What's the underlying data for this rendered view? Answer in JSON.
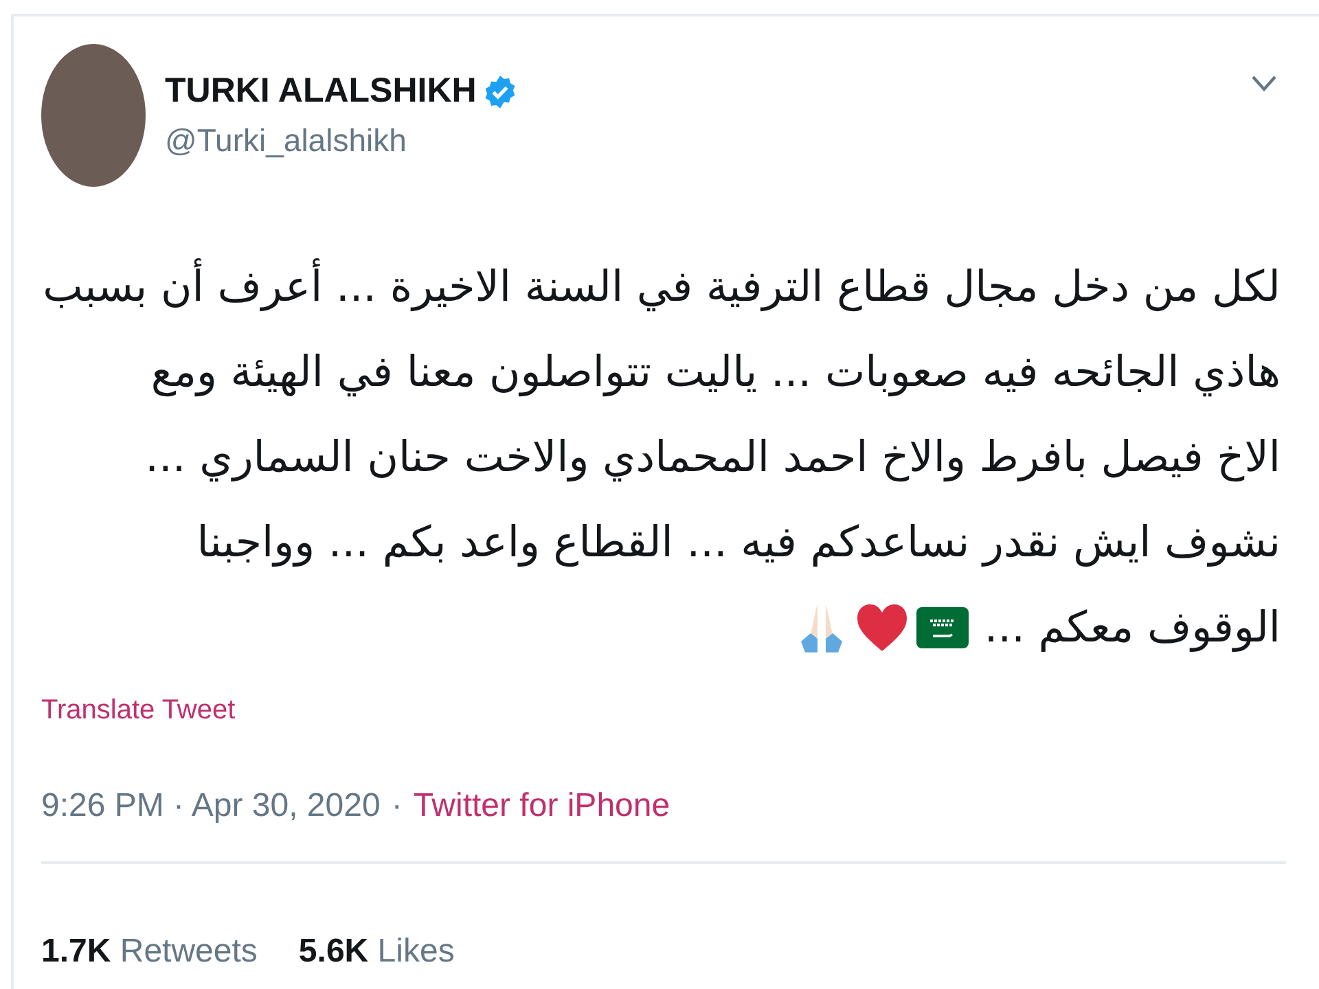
{
  "tweet": {
    "author": {
      "name": "TURKI ALALSHIKH",
      "verified": true,
      "handle": "@Turki_alalshikh"
    },
    "text_lines": [
      "لكل من دخل مجال قطاع الترفية في السنة الاخيرة ... أعرف أن بسبب",
      "هاذي الجائحه فيه صعوبات ... ياليت تتواصلون معنا في الهيئة ومع",
      "الاخ فيصل بافرط والاخ احمد المحمادي والاخت حنان السماري ...",
      "نشوف ايش نقدر نساعدكم فيه ... القطاع واعد بكم ... وواجبنا",
      "الوقوف معكم ..."
    ],
    "translate_link": "Translate Tweet",
    "time": "9:26 PM · Apr 30, 2020",
    "separator": "·",
    "source": "Twitter for iPhone",
    "retweets": {
      "count": "1.7K",
      "label": "Retweets"
    },
    "likes": {
      "count": "5.6K",
      "label": "Likes"
    }
  }
}
